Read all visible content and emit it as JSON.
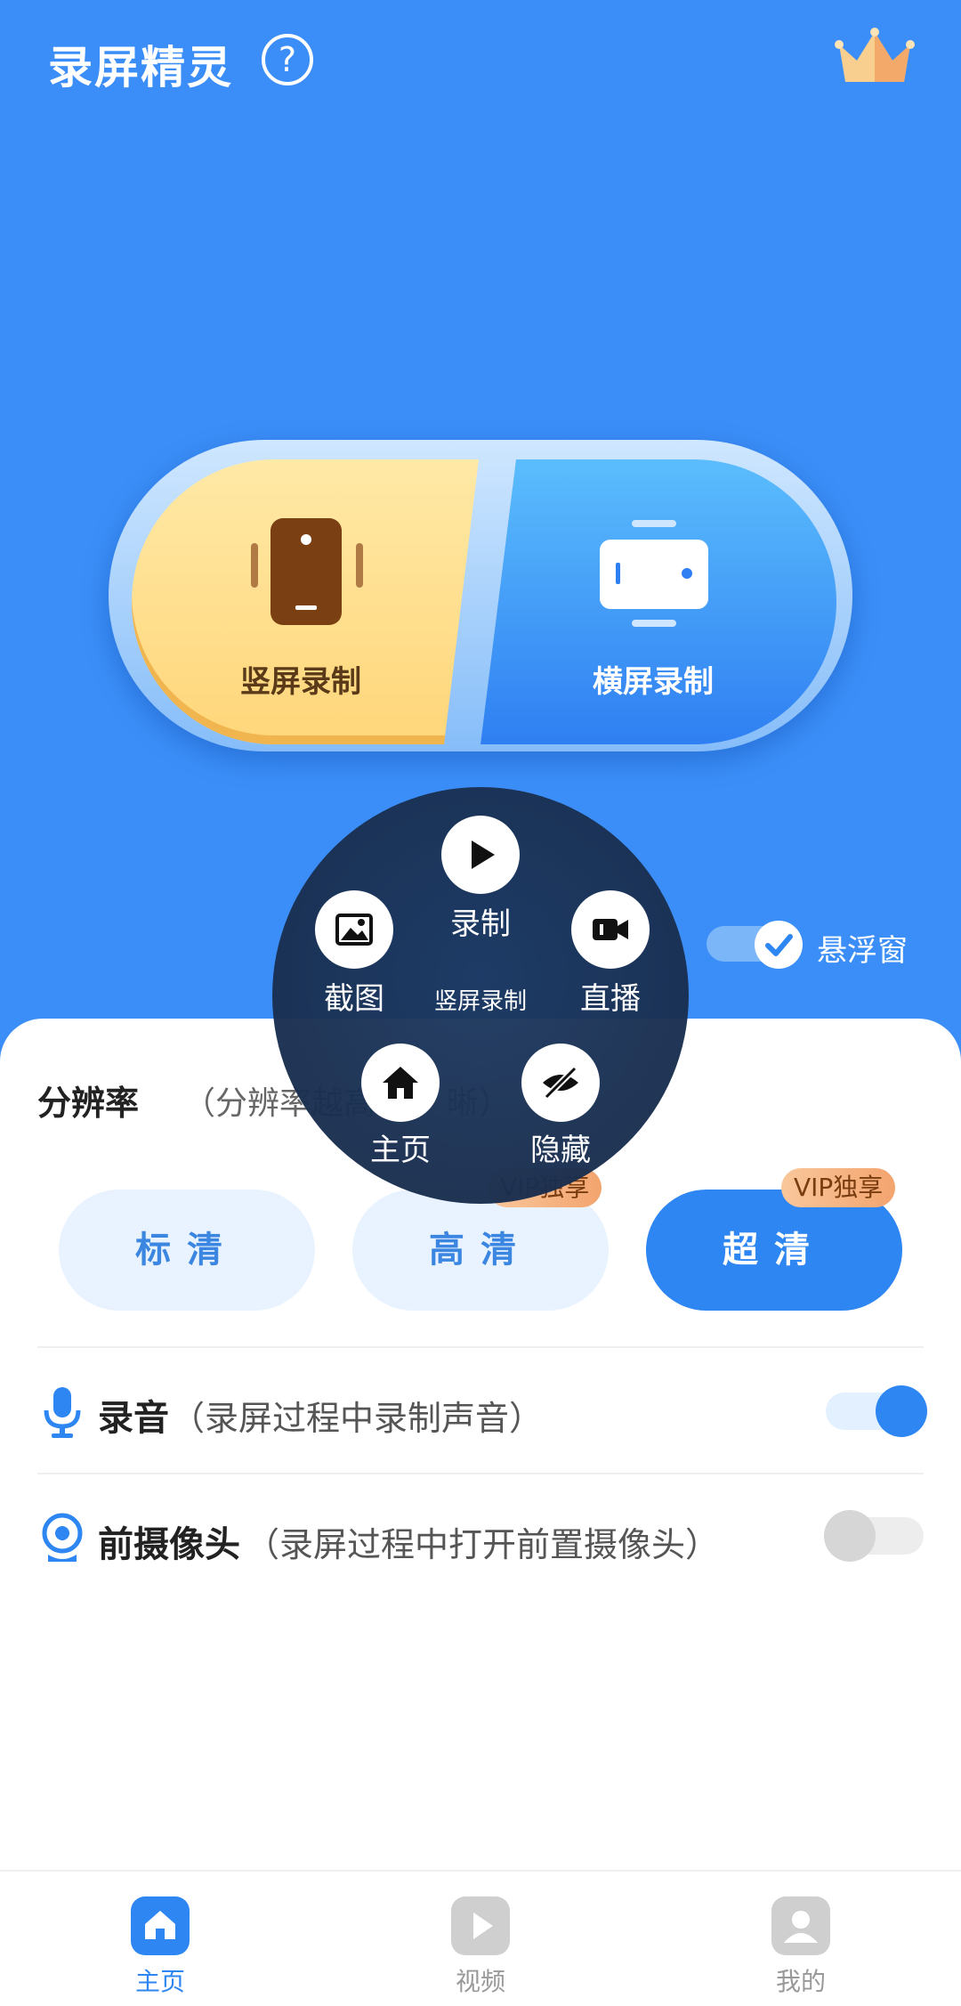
{
  "header": {
    "app_title": "录屏精灵",
    "help_icon": "question-mark-icon",
    "vip_icon": "crown-icon"
  },
  "record_modes": {
    "portrait_label": "竖屏录制",
    "landscape_label": "横屏录制"
  },
  "float_window": {
    "label": "悬浮窗",
    "checked": true
  },
  "floating_menu": {
    "record_label": "录制",
    "mode_label": "竖屏录制",
    "screenshot_label": "截图",
    "live_label": "直播",
    "home_label": "主页",
    "hide_label": "隐藏"
  },
  "resolution": {
    "title": "分辨率",
    "subtitle": "（分辨率越高",
    "subtitle_end": "晰）",
    "options": [
      {
        "label": "标清",
        "vip": ""
      },
      {
        "label": "高清",
        "vip": "VIP独享"
      },
      {
        "label": "超清",
        "vip": "VIP独享",
        "selected": true
      }
    ]
  },
  "settings": {
    "audio_title": "录音",
    "audio_desc": "（录屏过程中录制声音）",
    "audio_on": true,
    "camera_title": "前摄像头",
    "camera_desc": "（录屏过程中打开前置摄像头）",
    "camera_on": false
  },
  "tabbar": {
    "tabs": [
      {
        "label": "主页",
        "active": true
      },
      {
        "label": "视频",
        "active": false
      },
      {
        "label": "我的",
        "active": false
      }
    ]
  },
  "colors": {
    "primary_blue": "#3b8ef7",
    "accent_yellow": "#ffd67a",
    "vip_orange": "#f3a46e"
  }
}
